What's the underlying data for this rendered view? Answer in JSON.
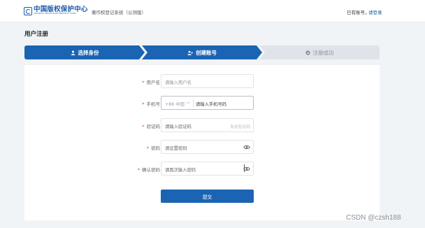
{
  "header": {
    "logo_cn": "中国版权保护中心",
    "logo_en": "COPYRIGHT PROTECTION CENTER OF CHINA",
    "system_name": "著作权登记系统（公测版）",
    "account_prompt": "已有账号，",
    "login_link": "请登录"
  },
  "page": {
    "title": "用户注册"
  },
  "steps": [
    {
      "label": "选择身份",
      "icon": "user-icon",
      "state": "done"
    },
    {
      "label": "创建账号",
      "icon": "user-add-icon",
      "state": "active"
    },
    {
      "label": "注册成功",
      "icon": "check-circle-icon",
      "state": "pending"
    }
  ],
  "form": {
    "username": {
      "label": "用户名",
      "placeholder": "请输入用户名"
    },
    "phone": {
      "label": "手机号",
      "prefix": "+86 中国 ﹀",
      "placeholder": "请输入手机号码"
    },
    "code": {
      "label": "验证码",
      "placeholder": "请输入验证码",
      "button": "发送验证码"
    },
    "password": {
      "label": "密码",
      "placeholder": "请设置密码"
    },
    "confirm": {
      "label": "确认密码",
      "placeholder": "请再次输入密码"
    },
    "submit": "提交"
  },
  "watermark": "CSDN @czsh188",
  "colors": {
    "primary": "#1b64b3",
    "required": "#e0352b",
    "step_pending": "#e0e4ea"
  }
}
